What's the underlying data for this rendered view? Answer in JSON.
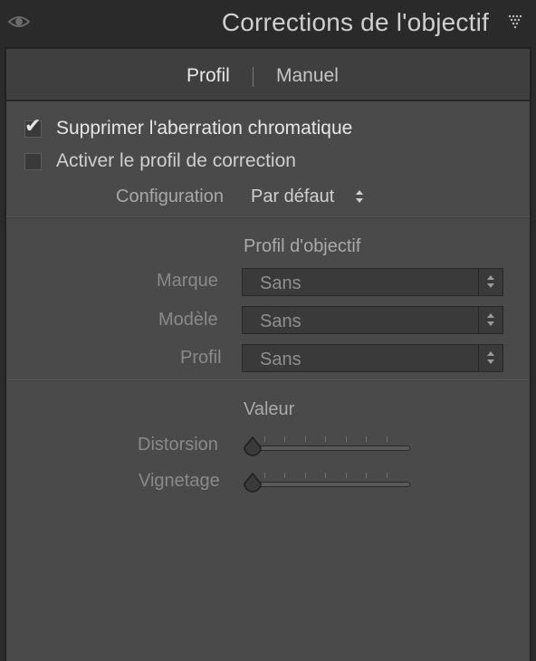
{
  "header": {
    "title": "Corrections de l'objectif",
    "visibility_icon": "eye-icon",
    "collapse_icon": "collapse-triangle-icon"
  },
  "tabs": [
    {
      "label": "Profil",
      "active": true
    },
    {
      "label": "Manuel",
      "active": false
    }
  ],
  "options": {
    "chromatic_aberration": {
      "label": "Supprimer l'aberration chromatique",
      "checked": true
    },
    "profile_correction": {
      "label": "Activer le profil de correction",
      "checked": false
    }
  },
  "setup": {
    "label": "Configuration",
    "value": "Par défaut"
  },
  "lens_profile": {
    "title": "Profil d'objectif",
    "make": {
      "label": "Marque",
      "value": "Sans"
    },
    "model": {
      "label": "Modèle",
      "value": "Sans"
    },
    "profile": {
      "label": "Profil",
      "value": "Sans"
    }
  },
  "amount": {
    "title": "Valeur",
    "distortion": {
      "label": "Distorsion",
      "value": 0
    },
    "vignetting": {
      "label": "Vignetage",
      "value": 0
    }
  },
  "colors": {
    "panel_bg": "#4a4a4a",
    "header_bg": "#2a2a2a",
    "text_active": "#e8e8e8"
  }
}
